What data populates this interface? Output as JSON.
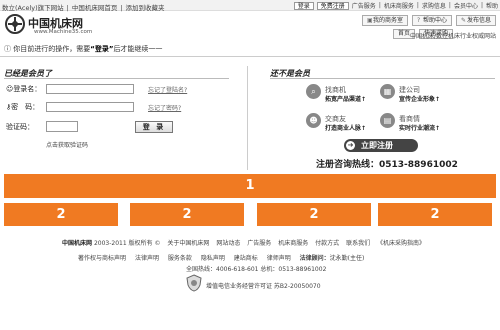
{
  "topbar": {
    "links": [
      "数立(Acely)旗下网站",
      "|",
      "中国机床网首页",
      "|",
      "添加到收藏夹"
    ],
    "login_button": "登录",
    "register_button": "免费注册",
    "menu": [
      "广告服务",
      "|",
      "机床商服务",
      "|",
      "求购信息",
      "|",
      "会员中心",
      "|",
      "帮助"
    ]
  },
  "logo": {
    "name": "中国机床网",
    "url": "www.Machine35.com"
  },
  "header": {
    "buttons": [
      "我的商务室",
      "帮助中心",
      "发布信息"
    ],
    "buttons2": [
      "首页",
      "快速求购"
    ],
    "slogan": "中国机床/数控机床行业权威网站"
  },
  "notice": {
    "prefix": "你目前进行的操作，需要",
    "keyword": "“登录”",
    "suffix": "后才能继续一一"
  },
  "login": {
    "title": "已经是会员了",
    "username_label": "登录名：",
    "password_label": "密　码：",
    "captcha_label": "验证码：",
    "forgot_name": "忘记了登陆名?",
    "forgot_password": "忘记了密码?",
    "captcha_link": "点击获取验证码",
    "submit": "登 录"
  },
  "register": {
    "title": "还不是会员",
    "features": [
      {
        "title": "找商机",
        "desc": "拓宽产品渠道↑",
        "icon": "search-magnifier-icon"
      },
      {
        "title": "建公司",
        "desc": "宣传企业形象↑",
        "icon": "building-icon"
      },
      {
        "title": "交商友",
        "desc": "打造商业人脉↑",
        "icon": "people-icon"
      },
      {
        "title": "看商情",
        "desc": "实时行业潮流↑",
        "icon": "book-icon"
      }
    ],
    "button": "立即注册",
    "hotline": "注册咨询热线：0513-88961002"
  },
  "placeholders": {
    "banner": "1",
    "blocks": [
      "2",
      "2",
      "2",
      "2"
    ]
  },
  "footer": {
    "brand": "中国机床网",
    "copyright": "2003-2011 版权所有 ©",
    "links1": [
      "关于中国机床网",
      "网站动态",
      "广告服务",
      "机床商服务",
      "付款方式",
      "联系我们",
      "《机床采购指南》"
    ],
    "links2": [
      "著作权与商标声明",
      "法律声明",
      "服务条款",
      "隐私声明",
      "建站商标",
      "律师声明"
    ],
    "law_label": "法律顾问：",
    "law_value": "沈永勤(主任)",
    "contact": "全国热线：4006-618-601 总机：0513-88961002",
    "icp": "增值电信业务经营许可证  苏B2-20050070"
  },
  "colors": {
    "placeholder": "#f07a22"
  }
}
